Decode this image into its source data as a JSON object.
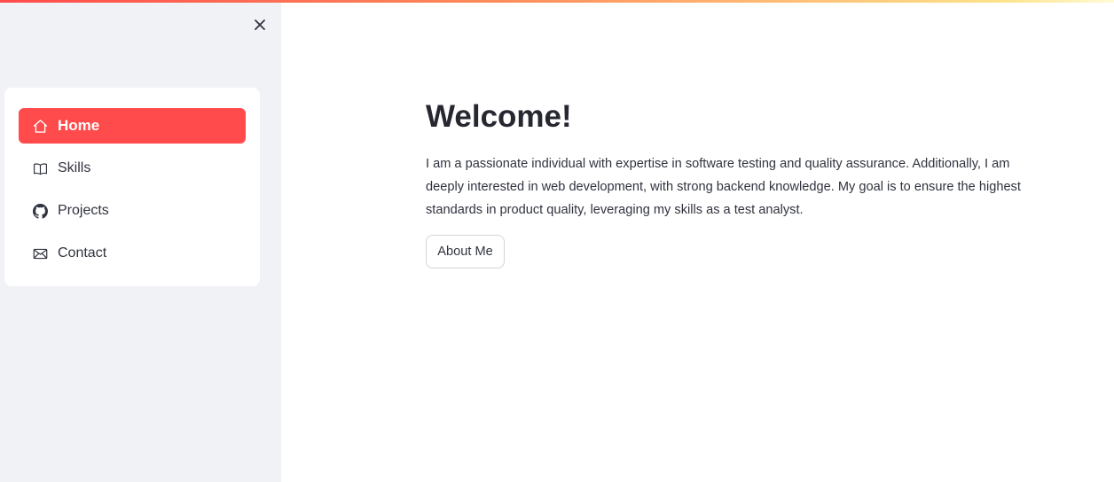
{
  "sidebar": {
    "close_label": "×",
    "nav_items": [
      {
        "label": "Home",
        "icon": "house-icon",
        "active": true
      },
      {
        "label": "Skills",
        "icon": "book-icon",
        "active": false
      },
      {
        "label": "Projects",
        "icon": "github-icon",
        "active": false
      },
      {
        "label": "Contact",
        "icon": "envelope-icon",
        "active": false
      }
    ]
  },
  "main": {
    "title": "Welcome!",
    "description": "I am a passionate individual with expertise in software testing and quality assurance. Additionally, I am deeply interested in web development, with strong backend knowledge. My goal is to ensure the highest standards in product quality, leveraging my skills as a test analyst.",
    "about_button": "About Me"
  },
  "colors": {
    "accent": "#ff4b4b",
    "sidebar_bg": "#f0f2f6",
    "text": "#31333f"
  }
}
